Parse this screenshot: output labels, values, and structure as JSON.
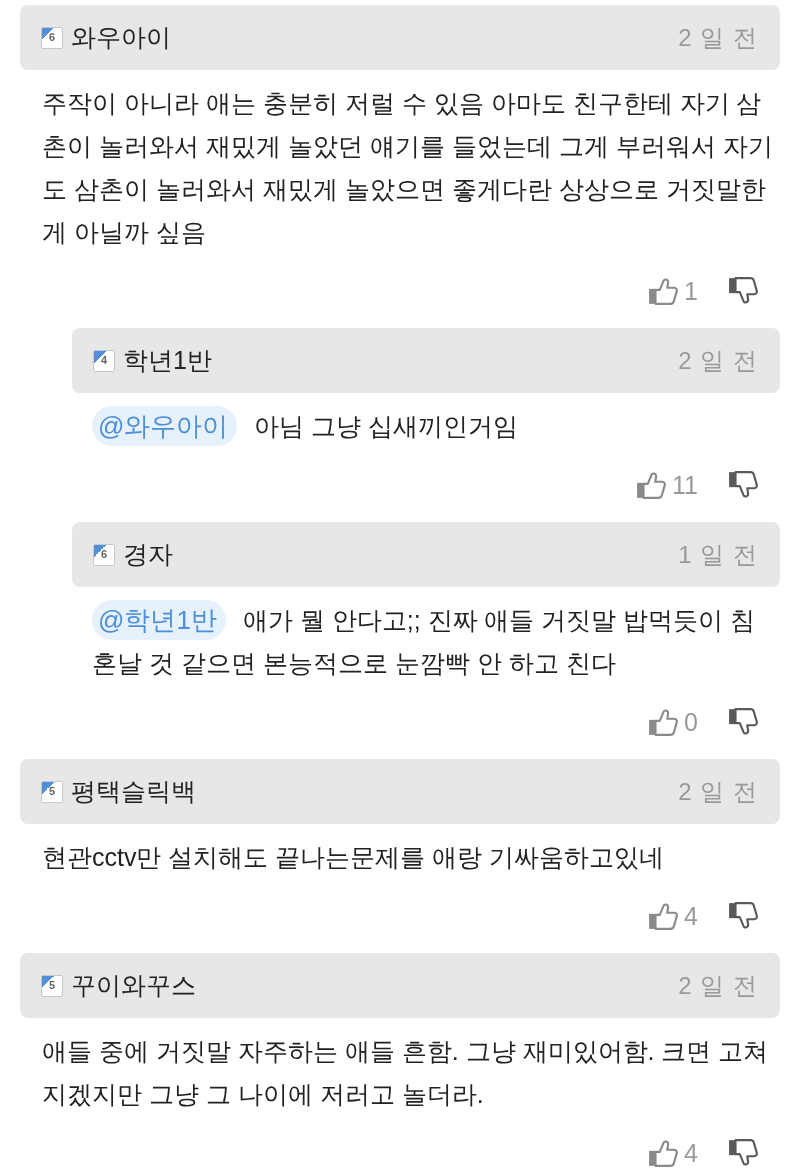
{
  "comments": [
    {
      "author": "와우아이",
      "rank": "6",
      "time": "2 일 전",
      "text": "주작이 아니라 애는 충분히 저럴 수 있음 아마도 친구한테 자기 삼촌이 놀러와서 재밌게 놀았던 얘기를 들었는데 그게 부러워서 자기도 삼촌이 놀러와서 재밌게 놀았으면 좋게다란 상상으로 거짓말한 게 아닐까 싶음",
      "likes": "1",
      "replies": [
        {
          "author": "학년1반",
          "rank": "4",
          "time": "2 일 전",
          "mention": "@와우아이",
          "text": "아님 그냥 십새끼인거임",
          "likes": "11"
        },
        {
          "author": "경자",
          "rank": "6",
          "time": "1 일 전",
          "mention": "@학년1반",
          "text": "애가 뭘 안다고;; 진짜 애들 거짓말 밥먹듯이 침혼날 것 같으면 본능적으로 눈깜빡 안 하고 친다",
          "likes": "0"
        }
      ]
    },
    {
      "author": "평택슬릭백",
      "rank": "5",
      "time": "2 일 전",
      "text": "현관cctv만 설치해도 끝나는문제를 애랑 기싸움하고있네",
      "likes": "4"
    },
    {
      "author": "꾸이와꾸스",
      "rank": "5",
      "time": "2 일 전",
      "text": "애들 중에 거짓말 자주하는 애들 흔함. 그냥 재미있어함. 크면 고쳐지겠지만 그냥 그 나이에 저러고 놀더라.",
      "likes": "4"
    }
  ]
}
